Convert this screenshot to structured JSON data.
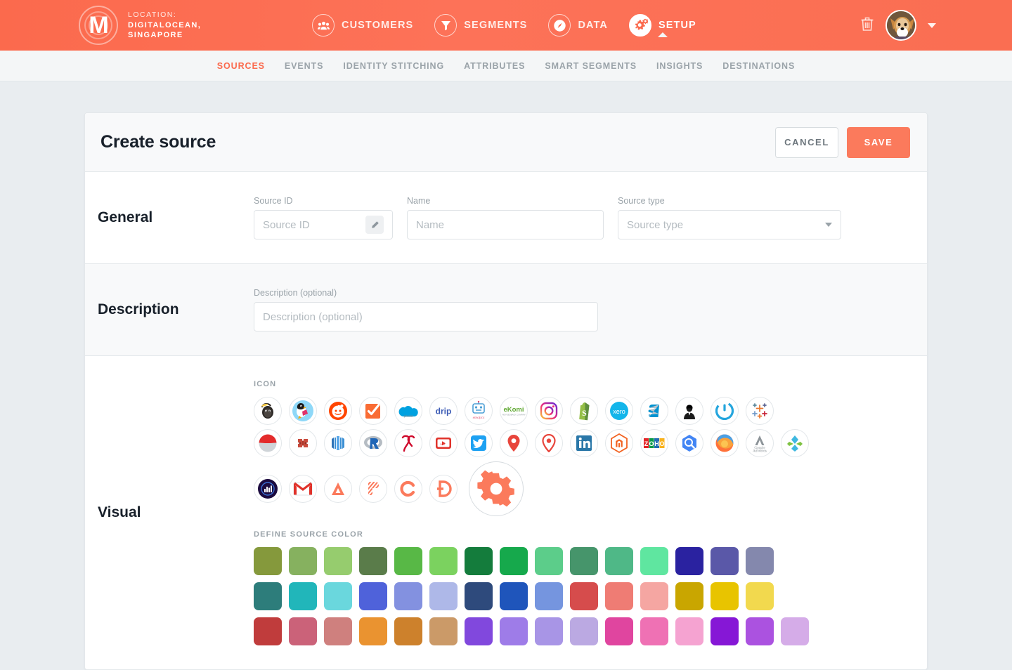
{
  "topbar": {
    "logo_letter": "M",
    "logo_icon": "labyrinth-logo-icon",
    "location_label": "LOCATION:",
    "location_line1": "DIGITALOCEAN,",
    "location_line2": "SINGAPORE",
    "nav": [
      {
        "label": "CUSTOMERS",
        "icon": "people-icon",
        "active": false
      },
      {
        "label": "SEGMENTS",
        "icon": "funnel-icon",
        "active": false
      },
      {
        "label": "DATA",
        "icon": "gauge-icon",
        "active": false
      },
      {
        "label": "SETUP",
        "icon": "gears-icon",
        "active": true
      }
    ],
    "trash_icon": "trash-icon",
    "avatar_icon": "user-avatar-dog",
    "caret_icon": "chevron-down-icon",
    "accent_color": "#fb6a4d"
  },
  "subnav": {
    "items": [
      {
        "label": "SOURCES",
        "active": true
      },
      {
        "label": "EVENTS",
        "active": false
      },
      {
        "label": "IDENTITY STITCHING",
        "active": false
      },
      {
        "label": "ATTRIBUTES",
        "active": false
      },
      {
        "label": "SMART SEGMENTS",
        "active": false
      },
      {
        "label": "INSIGHTS",
        "active": false
      },
      {
        "label": "DESTINATIONS",
        "active": false
      }
    ]
  },
  "card": {
    "title": "Create source",
    "cancel_label": "CANCEL",
    "save_label": "SAVE"
  },
  "general": {
    "section_label": "General",
    "source_id": {
      "label": "Source ID",
      "value": "",
      "placeholder": "Source ID",
      "edit_icon": "pencil-icon"
    },
    "name": {
      "label": "Name",
      "value": "",
      "placeholder": "Name"
    },
    "source_type": {
      "label": "Source type",
      "value": "",
      "placeholder": "Source type",
      "caret_icon": "chevron-down-icon"
    }
  },
  "description": {
    "section_label": "Description",
    "field": {
      "label": "Description (optional)",
      "value": "",
      "placeholder": "Description (optional)"
    }
  },
  "visual": {
    "section_label": "Visual",
    "icon_heading": "ICON",
    "color_heading": "DEFINE SOURCE COLOR",
    "icon_rows": [
      [
        {
          "name": "mailchimp-icon",
          "selected": false
        },
        {
          "name": "prestashop-icon",
          "selected": false
        },
        {
          "name": "reddit-icon",
          "selected": false
        },
        {
          "name": "checkbox-orange-icon",
          "selected": false
        },
        {
          "name": "salesforce-icon",
          "selected": false
        },
        {
          "name": "drip-icon",
          "selected": false
        },
        {
          "name": "emojics-icon",
          "selected": false
        },
        {
          "name": "ekomi-icon",
          "selected": false
        },
        {
          "name": "instagram-icon",
          "selected": false
        },
        {
          "name": "shopify-icon",
          "selected": false
        },
        {
          "name": "xero-icon",
          "selected": false
        },
        {
          "name": "sendinblue-icon",
          "selected": false
        },
        {
          "name": "person-portrait-icon",
          "selected": false
        },
        {
          "name": "power-button-icon",
          "selected": false
        },
        {
          "name": "tableau-icon",
          "selected": false
        }
      ],
      [
        {
          "name": "pepsi-icon",
          "selected": false
        },
        {
          "name": "bloodhound-icon",
          "selected": false
        },
        {
          "name": "redshift-icon",
          "selected": false
        },
        {
          "name": "r-language-icon",
          "selected": false
        },
        {
          "name": "qunar-icon",
          "selected": false
        },
        {
          "name": "youtube-icon",
          "selected": false
        },
        {
          "name": "twitter-icon",
          "selected": false
        },
        {
          "name": "map-pin-red-icon",
          "selected": false
        },
        {
          "name": "map-pin-outline-icon",
          "selected": false
        },
        {
          "name": "linkedin-icon",
          "selected": false
        },
        {
          "name": "magento-icon",
          "selected": false
        },
        {
          "name": "zoho-icon",
          "selected": false
        },
        {
          "name": "bigquery-icon",
          "selected": false
        },
        {
          "name": "firefox-icon",
          "selected": false
        },
        {
          "name": "google-adwords-icon",
          "selected": false
        },
        {
          "name": "xendit-leaf-icon",
          "selected": false
        }
      ],
      [
        {
          "name": "analytics-dark-icon",
          "selected": false
        },
        {
          "name": "gmail-icon",
          "selected": false
        },
        {
          "name": "letter-a-icon",
          "selected": false
        },
        {
          "name": "stripes-icon",
          "selected": false
        },
        {
          "name": "letter-c-icon",
          "selected": false
        },
        {
          "name": "letter-d-icon",
          "selected": false
        },
        {
          "name": "gear-icon",
          "selected": true
        }
      ]
    ],
    "colors": [
      [
        "#85993c",
        "#86b15f",
        "#96cc6e",
        "#5a7c4a",
        "#58b846",
        "#7bd25f",
        "#147c3c",
        "#16a94c",
        "#5ccd8a",
        "#46956b",
        "#4fb887",
        "#5fe6a0",
        "#2a22a0",
        "#5a58a8",
        "#8488ad"
      ],
      [
        "#2d7d7b",
        "#21b6ba",
        "#6ad7dd",
        "#4f62da",
        "#8391e0",
        "#aeb8e8",
        "#2e4a7c",
        "#1f55bb",
        "#7595df",
        "#d64c4c",
        "#ef7c74",
        "#f5a6a2",
        "#c9a600",
        "#e8c400",
        "#f2d94e"
      ],
      [
        "#c03c3c",
        "#cb6279",
        "#cf807e",
        "#ea9330",
        "#cd812c",
        "#cb9a68",
        "#8148dd",
        "#9e7ce8",
        "#a895e6",
        "#bba9e2",
        "#e0459f",
        "#ef71b4",
        "#f5a3d1",
        "#8617d6",
        "#ab52e0",
        "#d5ace8"
      ]
    ]
  }
}
